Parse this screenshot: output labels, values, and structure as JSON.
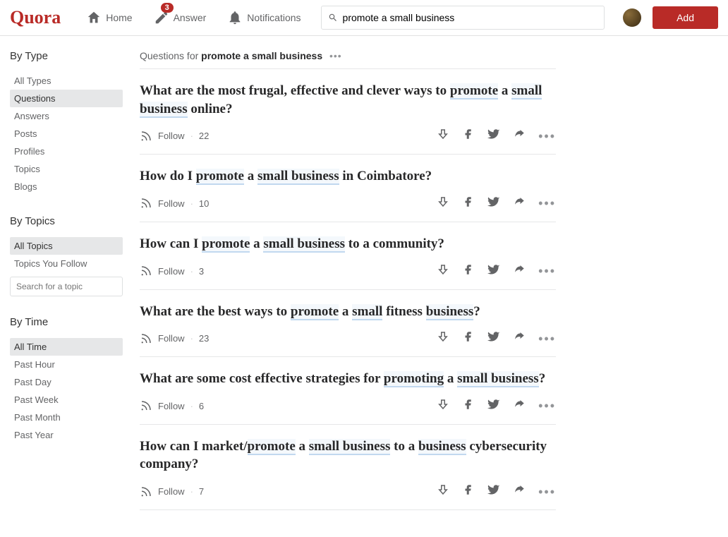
{
  "header": {
    "logo": "Quora",
    "nav": {
      "home": "Home",
      "answer": "Answer",
      "answer_badge": "3",
      "notifications": "Notifications"
    },
    "search_value": "promote a small business",
    "add_button": "Add"
  },
  "sidebar": {
    "type": {
      "title": "By Type",
      "items": [
        "All Types",
        "Questions",
        "Answers",
        "Posts",
        "Profiles",
        "Topics",
        "Blogs"
      ],
      "active": "Questions"
    },
    "topics": {
      "title": "By Topics",
      "items": [
        "All Topics",
        "Topics You Follow"
      ],
      "active": "All Topics",
      "search_placeholder": "Search for a topic"
    },
    "time": {
      "title": "By Time",
      "items": [
        "All Time",
        "Past Hour",
        "Past Day",
        "Past Week",
        "Past Month",
        "Past Year"
      ],
      "active": "All Time"
    }
  },
  "results": {
    "prefix": "Questions for ",
    "query": "promote a small business",
    "follow_label": "Follow",
    "questions": [
      {
        "parts": [
          {
            "t": "What are the most frugal, effective and clever ways to "
          },
          {
            "t": "promote",
            "hl": true
          },
          {
            "t": " a "
          },
          {
            "t": "small business",
            "hl": true
          },
          {
            "t": " online?"
          }
        ],
        "follow_count": "22"
      },
      {
        "parts": [
          {
            "t": "How do I "
          },
          {
            "t": "promote",
            "hl": true
          },
          {
            "t": " a "
          },
          {
            "t": "small business",
            "hl": true
          },
          {
            "t": " in Coimbatore?"
          }
        ],
        "follow_count": "10"
      },
      {
        "parts": [
          {
            "t": "How can I "
          },
          {
            "t": "promote",
            "hl": true
          },
          {
            "t": " a "
          },
          {
            "t": "small business",
            "hl": true
          },
          {
            "t": " to a community?"
          }
        ],
        "follow_count": "3"
      },
      {
        "parts": [
          {
            "t": "What are the best ways to "
          },
          {
            "t": "promote",
            "hl": true
          },
          {
            "t": " a "
          },
          {
            "t": "small",
            "hl": true
          },
          {
            "t": " fitness "
          },
          {
            "t": "business",
            "hl": true
          },
          {
            "t": "?"
          }
        ],
        "follow_count": "23"
      },
      {
        "parts": [
          {
            "t": "What are some cost effective strategies for "
          },
          {
            "t": "promoting",
            "hl": true
          },
          {
            "t": " a "
          },
          {
            "t": "small business",
            "hl": true
          },
          {
            "t": "?"
          }
        ],
        "follow_count": "6"
      },
      {
        "parts": [
          {
            "t": "How can I market/"
          },
          {
            "t": "promote",
            "hl": true
          },
          {
            "t": " a "
          },
          {
            "t": "small business",
            "hl": true
          },
          {
            "t": " to a "
          },
          {
            "t": "business",
            "hl": true
          },
          {
            "t": " cybersecurity company?"
          }
        ],
        "follow_count": "7"
      }
    ]
  }
}
